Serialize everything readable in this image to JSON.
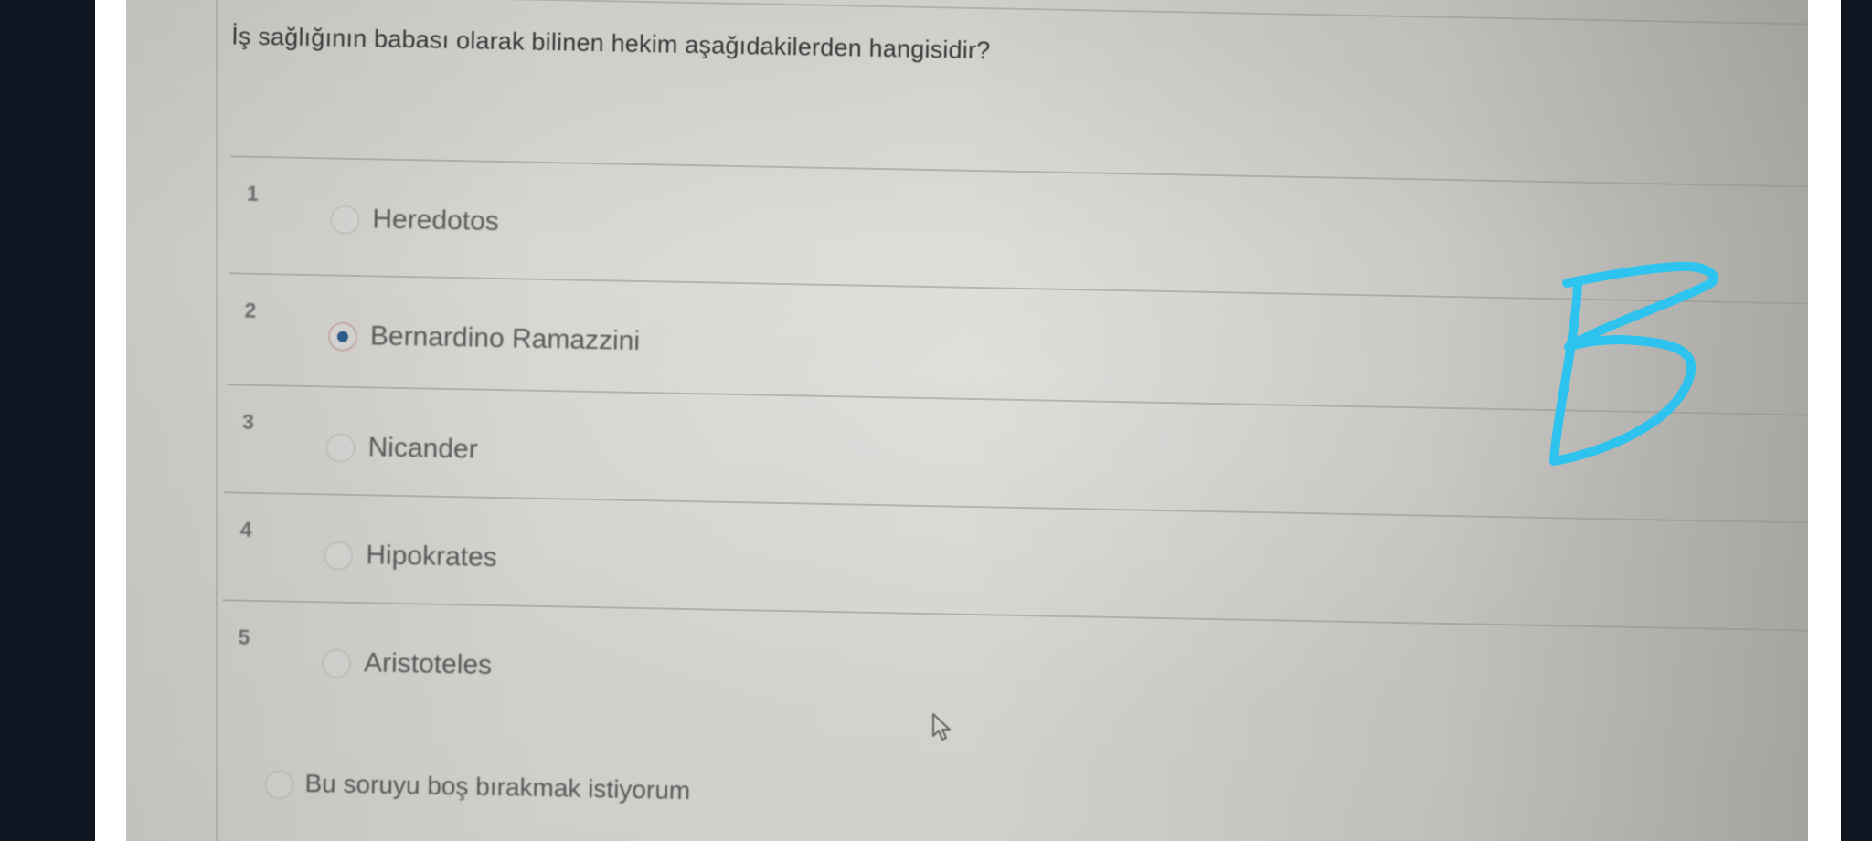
{
  "question": {
    "text": "İş sağlığının babası olarak bilinen hekim aşağıdakilerden hangisidir?"
  },
  "options": [
    {
      "number": "1",
      "label": "Heredotos",
      "selected": false
    },
    {
      "number": "2",
      "label": "Bernardino Ramazzini",
      "selected": true
    },
    {
      "number": "3",
      "label": "Nicander",
      "selected": false
    },
    {
      "number": "4",
      "label": "Hipokrates",
      "selected": false
    },
    {
      "number": "5",
      "label": "Aristoteles",
      "selected": false
    }
  ],
  "skip_option": {
    "label": "Bu soruyu boş bırakmak istiyorum",
    "selected": false
  },
  "annotation": {
    "handwritten_letter": "B",
    "color": "#2ec4f0"
  },
  "colors": {
    "selected_radio": "#2d5a8a",
    "screen_background": "#d6d5d1",
    "bezel": "#0e1420"
  },
  "icons": {
    "cursor": "mouse-pointer-icon"
  }
}
